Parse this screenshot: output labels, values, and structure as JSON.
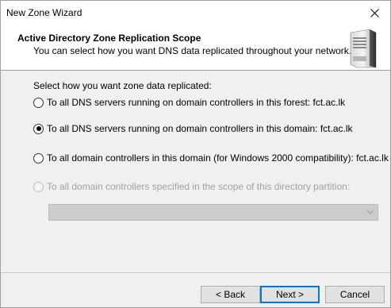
{
  "window": {
    "title": "New Zone Wizard"
  },
  "header": {
    "title": "Active Directory Zone Replication Scope",
    "subtitle": "You can select how you want DNS data replicated throughout your network.",
    "icon": "server-icon"
  },
  "form": {
    "prompt": "Select how you want zone data replicated:",
    "options": [
      {
        "label": "To all DNS servers running on domain controllers in this forest: fct.ac.lk",
        "checked": false,
        "disabled": false
      },
      {
        "label": "To all DNS servers running on domain controllers in this domain: fct.ac.lk",
        "checked": true,
        "disabled": false
      },
      {
        "label": "To all domain controllers in this domain (for Windows 2000 compatibility): fct.ac.lk",
        "checked": false,
        "disabled": false
      },
      {
        "label": "To all domain controllers specified in the scope of this directory partition:",
        "checked": false,
        "disabled": true
      }
    ],
    "partition_select": {
      "value": "",
      "disabled": true
    }
  },
  "footer": {
    "back_label": "< Back",
    "next_label": "Next >",
    "cancel_label": "Cancel"
  },
  "colors": {
    "accent": "#0078d7",
    "disabled_text": "#a0a0a0"
  }
}
